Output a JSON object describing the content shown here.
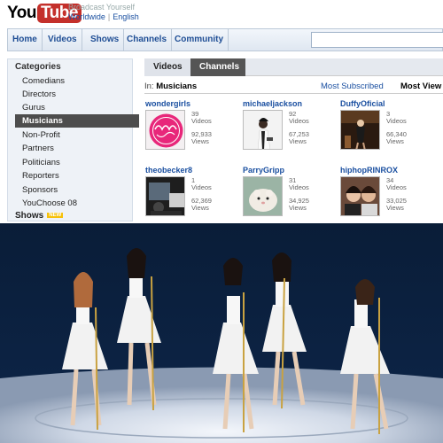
{
  "header": {
    "logo_you": "You",
    "logo_tube": "Tube",
    "tagline": "Broadcast Yourself",
    "region": "Worldwide",
    "separator": "|",
    "language": "English"
  },
  "nav": {
    "items": [
      "Home",
      "Videos",
      "Shows",
      "Channels",
      "Community"
    ],
    "search_value": ""
  },
  "sidebar": {
    "title": "Categories",
    "items": [
      "Comedians",
      "Directors",
      "Gurus",
      "Musicians",
      "Non-Profit",
      "Partners",
      "Politicians",
      "Reporters",
      "Sponsors",
      "YouChoose 08"
    ],
    "selected": "Musicians",
    "shows_label": "Shows",
    "new_badge": "NEW"
  },
  "main": {
    "tabs": [
      "Videos",
      "Channels"
    ],
    "active_tab": "Channels",
    "in_label": "In:",
    "in_value": "Musicians",
    "sort_link": "Most Subscribed",
    "sort_active": "Most View"
  },
  "channels": [
    {
      "name": "wondergirls",
      "videos": "39",
      "videos_label": "Videos",
      "views": "92,933",
      "views_label": "Views",
      "thumb": "pink-logo"
    },
    {
      "name": "michaeljackson",
      "videos": "92",
      "videos_label": "Videos",
      "views": "67,253",
      "views_label": "Views",
      "thumb": "mj-white"
    },
    {
      "name": "DuffyOficial",
      "videos": "3",
      "videos_label": "Videos",
      "views": "66,340",
      "views_label": "Views",
      "thumb": "stage-dark"
    },
    {
      "name": "theobecker8",
      "videos": "1",
      "videos_label": "Videos",
      "views": "62,369",
      "views_label": "Views",
      "thumb": "dark-car"
    },
    {
      "name": "ParryGripp",
      "videos": "31",
      "videos_label": "Videos",
      "views": "34,925",
      "views_label": "Views",
      "thumb": "hamster"
    },
    {
      "name": "hiphopRINROX",
      "videos": "34",
      "videos_label": "Videos",
      "views": "33,025",
      "views_label": "Views",
      "thumb": "two-girls"
    }
  ],
  "colors": {
    "link": "#1a4fa0",
    "logo_red": "#c4302b",
    "selected_bg": "#4d4d4d",
    "stage_blue": "#0b1f3a"
  }
}
